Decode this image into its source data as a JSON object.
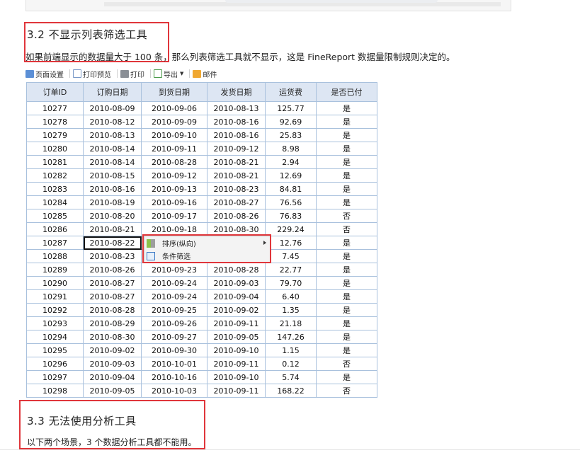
{
  "section32": {
    "heading": "3.2 不显示列表筛选工具",
    "paragraph": "如果前端显示的数据量大于 100 条，那么列表筛选工具就不显示，这是 FineReport 数据量限制规则决定的。"
  },
  "toolbar": {
    "items": [
      {
        "label": "页面设置",
        "icon": "page-setup-icon"
      },
      {
        "label": "打印预览",
        "icon": "print-preview-icon"
      },
      {
        "label": "打印",
        "icon": "printer-icon"
      },
      {
        "label": "导出",
        "icon": "export-icon"
      },
      {
        "label": "邮件",
        "icon": "mail-icon"
      }
    ]
  },
  "table": {
    "columns": [
      "订单ID",
      "订购日期",
      "到货日期",
      "发货日期",
      "运货费",
      "是否已付"
    ],
    "rows": [
      [
        "10277",
        "2010-08-09",
        "2010-09-06",
        "2010-08-13",
        "125.77",
        "是"
      ],
      [
        "10278",
        "2010-08-12",
        "2010-09-09",
        "2010-08-16",
        "92.69",
        "是"
      ],
      [
        "10279",
        "2010-08-13",
        "2010-09-10",
        "2010-08-16",
        "25.83",
        "是"
      ],
      [
        "10280",
        "2010-08-14",
        "2010-09-11",
        "2010-09-12",
        "8.98",
        "是"
      ],
      [
        "10281",
        "2010-08-14",
        "2010-08-28",
        "2010-08-21",
        "2.94",
        "是"
      ],
      [
        "10282",
        "2010-08-15",
        "2010-09-12",
        "2010-08-21",
        "12.69",
        "是"
      ],
      [
        "10283",
        "2010-08-16",
        "2010-09-13",
        "2010-08-23",
        "84.81",
        "是"
      ],
      [
        "10284",
        "2010-08-19",
        "2010-09-16",
        "2010-08-27",
        "76.56",
        "是"
      ],
      [
        "10285",
        "2010-08-20",
        "2010-09-17",
        "2010-08-26",
        "76.83",
        "否"
      ],
      [
        "10286",
        "2010-08-21",
        "2010-09-18",
        "2010-08-30",
        "229.24",
        "否"
      ],
      [
        "10287",
        "2010-08-22",
        "",
        "",
        "12.76",
        "是"
      ],
      [
        "10288",
        "2010-08-23",
        "",
        "",
        "7.45",
        "是"
      ],
      [
        "10289",
        "2010-08-26",
        "2010-09-23",
        "2010-08-28",
        "22.77",
        "是"
      ],
      [
        "10290",
        "2010-08-27",
        "2010-09-24",
        "2010-09-03",
        "79.70",
        "是"
      ],
      [
        "10291",
        "2010-08-27",
        "2010-09-24",
        "2010-09-04",
        "6.40",
        "是"
      ],
      [
        "10292",
        "2010-08-28",
        "2010-09-25",
        "2010-09-02",
        "1.35",
        "是"
      ],
      [
        "10293",
        "2010-08-29",
        "2010-09-26",
        "2010-09-11",
        "21.18",
        "是"
      ],
      [
        "10294",
        "2010-08-30",
        "2010-09-27",
        "2010-09-05",
        "147.26",
        "是"
      ],
      [
        "10295",
        "2010-09-02",
        "2010-09-30",
        "2010-09-10",
        "1.15",
        "是"
      ],
      [
        "10296",
        "2010-09-03",
        "2010-10-01",
        "2010-09-11",
        "0.12",
        "否"
      ],
      [
        "10297",
        "2010-09-04",
        "2010-10-16",
        "2010-09-10",
        "5.74",
        "是"
      ],
      [
        "10298",
        "2010-09-05",
        "2010-10-03",
        "2010-09-11",
        "168.22",
        "否"
      ]
    ]
  },
  "context_menu": {
    "items": [
      {
        "label": "排序(纵向)",
        "icon": "sort-icon",
        "has_submenu": true
      },
      {
        "label": "条件筛选",
        "icon": "filter-icon",
        "has_submenu": false
      }
    ]
  },
  "section33": {
    "heading": "3.3 无法使用分析工具",
    "paragraph": "以下两个场景，3 个数据分析工具都不能用。"
  },
  "colors": {
    "highlight_box": "#e0363b",
    "header_bg": "#dde6f3",
    "grid_line": "#a9c1dd"
  }
}
